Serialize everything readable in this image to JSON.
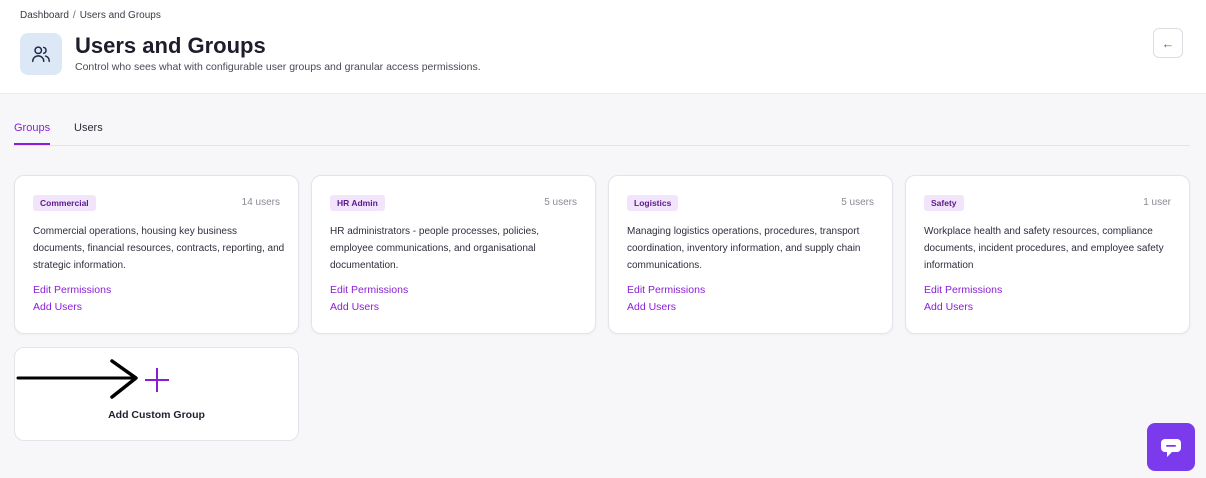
{
  "breadcrumb": {
    "home": "Dashboard",
    "separator": "/",
    "current": "Users and Groups"
  },
  "header": {
    "title": "Users and Groups",
    "subtitle": "Control who sees what with configurable user groups and granular access permissions.",
    "page_icon": "users-icon",
    "back_icon": "arrow-left-icon"
  },
  "tabs": [
    {
      "label": "Groups",
      "active": true
    },
    {
      "label": "Users",
      "active": false
    }
  ],
  "groups": [
    {
      "name": "Commercial",
      "count": "14 users",
      "description": "Commercial operations, housing key business documents, financial resources, contracts, reporting, and strategic information.",
      "edit_label": "Edit Permissions",
      "add_label": "Add Users"
    },
    {
      "name": "HR Admin",
      "count": "5 users",
      "description": "HR administrators - people processes, policies, employee communications, and organisational documentation.",
      "edit_label": "Edit Permissions",
      "add_label": "Add Users"
    },
    {
      "name": "Logistics",
      "count": "5 users",
      "description": "Managing logistics operations, procedures, transport coordination, inventory information, and supply chain communications.",
      "edit_label": "Edit Permissions",
      "add_label": "Add Users"
    },
    {
      "name": "Safety",
      "count": "1 user",
      "description": "Workplace health and safety resources, compliance documents, incident procedures, and employee safety information",
      "edit_label": "Edit Permissions",
      "add_label": "Add Users"
    }
  ],
  "custom_group": {
    "label": "Add Custom Group",
    "icon": "plus-icon"
  },
  "annotation": {
    "icon": "arrow-right-icon"
  },
  "chat": {
    "icon": "chat-icon"
  },
  "colors": {
    "accent": "#8a1ed6",
    "badge_bg": "#f1e4fb",
    "chat_bg": "#7c3aed",
    "icon_bg": "#dde8f7"
  }
}
